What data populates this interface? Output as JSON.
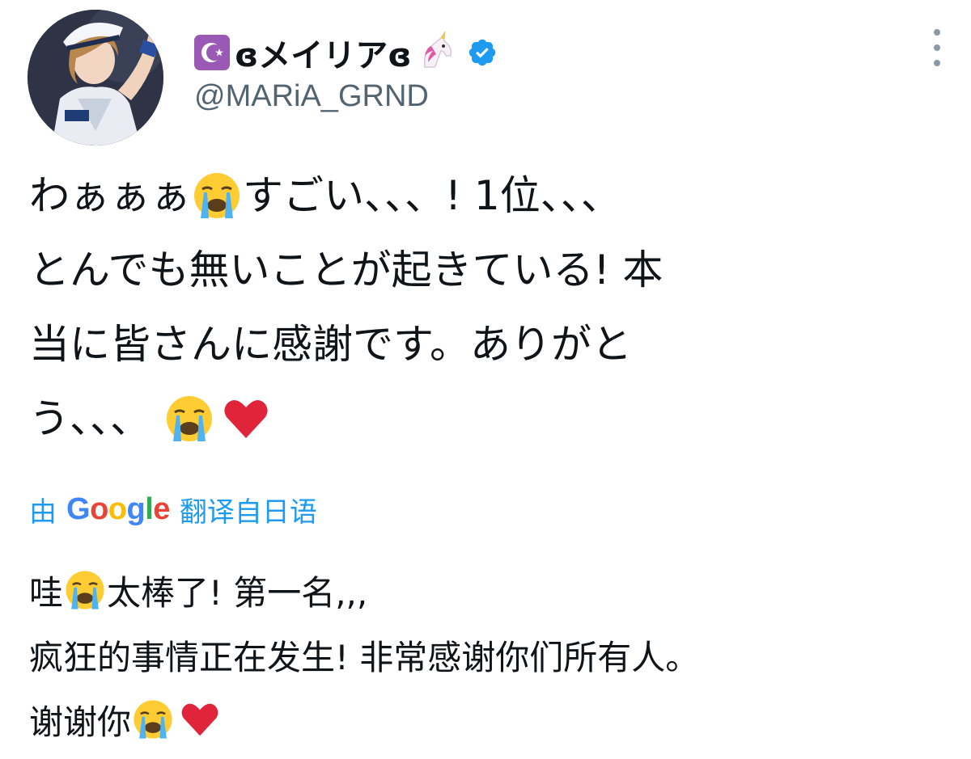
{
  "author": {
    "display_name": "ɞメイリアɞ",
    "handle": "@MARiA_GRND",
    "verified": true,
    "name_icons": [
      "star-and-crescent-icon",
      "unicorn-icon"
    ]
  },
  "tweet": {
    "lines": [
      {
        "before": "わぁぁぁ",
        "emoji": "crying-face",
        "after": "すごい、、、! 1位、、、"
      },
      {
        "text": "とんでも無いことが起きている! 本"
      },
      {
        "text": "当に皆さんに感謝です。ありがと"
      },
      {
        "before": "う、、、 ",
        "emoji": "crying-face",
        "emoji2": "red-heart"
      }
    ]
  },
  "translation": {
    "prefix": "由",
    "provider": "Google",
    "suffix": "翻译自日语",
    "lines": [
      {
        "before": "哇",
        "emoji": "crying-face",
        "after": "太棒了! 第一名,,,"
      },
      {
        "text": "疯狂的事情正在发生! 非常感谢你们所有人。"
      },
      {
        "before": "谢谢你",
        "emoji": "crying-face",
        "emoji2": "red-heart"
      }
    ]
  },
  "colors": {
    "link": "#1d9bf0",
    "verified": "#1d9bf0",
    "secondary_text": "#536471",
    "crescent_box": "#9b59b6",
    "heart": "#e0243a"
  }
}
